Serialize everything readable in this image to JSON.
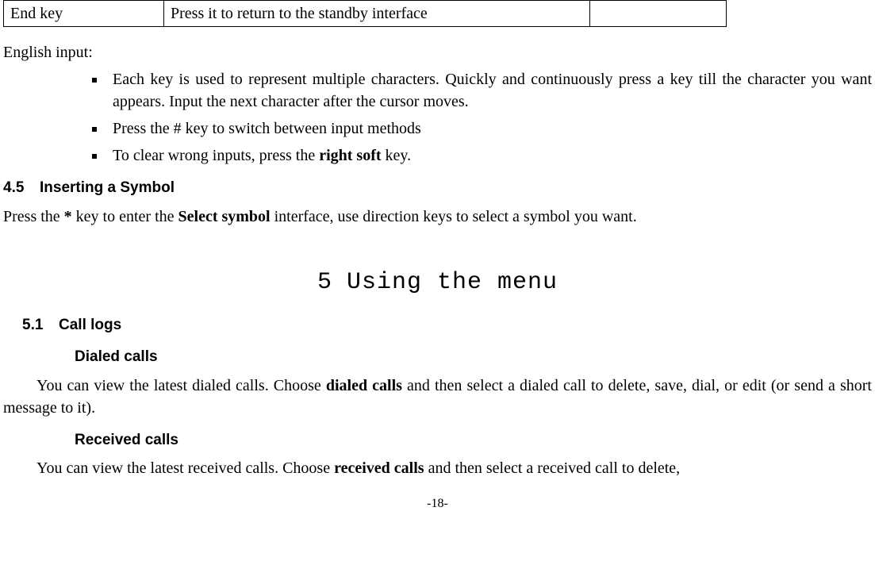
{
  "table": {
    "c1": "End key",
    "c2": "Press it to return to the standby interface",
    "c3": ""
  },
  "english_input_label": "English input:",
  "bullets": {
    "b1": "Each key is used to represent multiple characters. Quickly and continuously press a key till the character you want appears. Input the next character after the cursor moves.",
    "b2": "Press the # key to switch between input methods",
    "b3_prefix": "To clear wrong inputs, press the ",
    "b3_bold": "right soft",
    "b3_suffix": " key."
  },
  "sec45_num": "4.5",
  "sec45_title": "Inserting a Symbol",
  "sec45_body": {
    "p1a": "Press the ",
    "p1b": "*",
    "p1c": " key to enter the ",
    "p1d": "Select symbol",
    "p1e": " interface, use direction keys to select a symbol you want."
  },
  "chapter_num": "5",
  "chapter_title": "Using the menu",
  "sec51_num": "5.1",
  "sec51_title": "Call logs",
  "dialed_heading": "Dialed calls",
  "dialed_body": {
    "a": "You can view the latest dialed calls. Choose ",
    "b": "dialed calls",
    "c": " and then select a dialed call to delete, save, dial, or edit (or send a short message to it)."
  },
  "received_heading": "Received calls",
  "received_body": {
    "a": "You can view the latest received calls. Choose ",
    "b": "received calls",
    "c": " and then select a received call to delete,"
  },
  "page_number": "-18-"
}
